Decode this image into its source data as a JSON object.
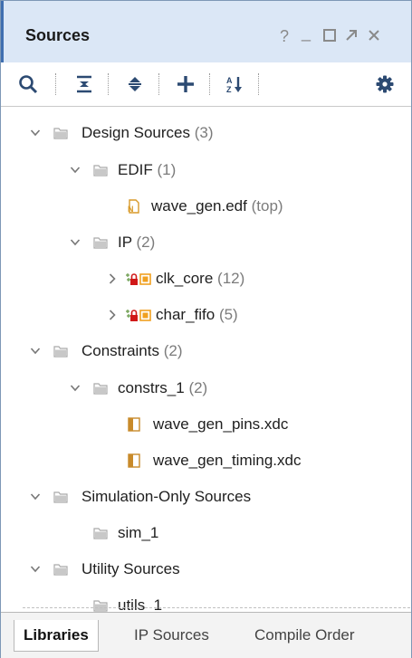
{
  "window": {
    "title": "Sources",
    "controls": [
      "?",
      "_",
      "□",
      "⇱",
      "✕"
    ]
  },
  "toolbar": {
    "buttons": [
      "search",
      "collapse-all",
      "expand-all",
      "add-sources",
      "sort",
      "settings"
    ],
    "sort_glyph": "A↓Z"
  },
  "tree": {
    "design_sources": {
      "label": "Design Sources",
      "count": "(3)"
    },
    "edif": {
      "label": "EDIF",
      "count": "(1)"
    },
    "wave_gen_edf": {
      "label": "wave_gen.edf",
      "count": "(top)"
    },
    "ip": {
      "label": "IP",
      "count": "(2)"
    },
    "clk_core": {
      "label": "clk_core",
      "count": "(12)"
    },
    "char_fifo": {
      "label": "char_fifo",
      "count": "(5)"
    },
    "constraints": {
      "label": "Constraints",
      "count": "(2)"
    },
    "constrs_1": {
      "label": "constrs_1",
      "count": "(2)"
    },
    "pins_xdc": {
      "label": "wave_gen_pins.xdc"
    },
    "timing_xdc": {
      "label": "wave_gen_timing.xdc"
    },
    "sim_sources": {
      "label": "Simulation-Only Sources"
    },
    "sim_1": {
      "label": "sim_1"
    },
    "utility_sources": {
      "label": "Utility Sources"
    },
    "utils_1": {
      "label": "utils_1"
    }
  },
  "tabs": {
    "libraries": "Libraries",
    "ip_sources": "IP Sources",
    "compile_order": "Compile Order",
    "active": "Libraries"
  },
  "colors": {
    "title_bg": "#dbe7f6",
    "accent": "#3f6fb0",
    "folder": "#b8b8b8",
    "ip_orange": "#f0a020",
    "lock_red": "#d01818",
    "xdc_brown": "#c88a2a"
  }
}
